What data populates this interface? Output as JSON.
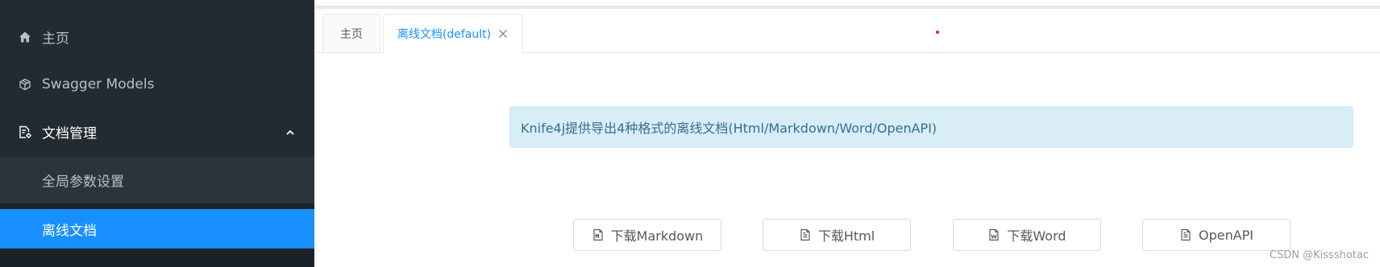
{
  "sidebar": {
    "items": [
      {
        "label": "主页",
        "icon": "home-icon"
      },
      {
        "label": "Swagger Models",
        "icon": "cube-icon"
      },
      {
        "label": "文档管理",
        "icon": "doc-settings-icon",
        "expanded": true
      },
      {
        "label": "全局参数设置"
      },
      {
        "label": "离线文档",
        "active": true
      }
    ]
  },
  "tabs": [
    {
      "label": "主页"
    },
    {
      "label": "离线文档(default)",
      "active": true
    }
  ],
  "alert": {
    "text": "Knife4j提供导出4种格式的离线文档(Html/Markdown/Word/OpenAPI)"
  },
  "buttons": [
    {
      "label": "下载Markdown",
      "icon": "markdown-file-icon"
    },
    {
      "label": "下载Html",
      "icon": "file-text-icon"
    },
    {
      "label": "下载Word",
      "icon": "word-file-icon"
    },
    {
      "label": "OpenAPI",
      "icon": "file-text-icon"
    }
  ],
  "watermark": "CSDN @Kissshotac",
  "colors": {
    "sidebar_bg": "#222b32",
    "active": "#1890ff",
    "alert_bg": "#d9edf7",
    "alert_text": "#31708f"
  }
}
